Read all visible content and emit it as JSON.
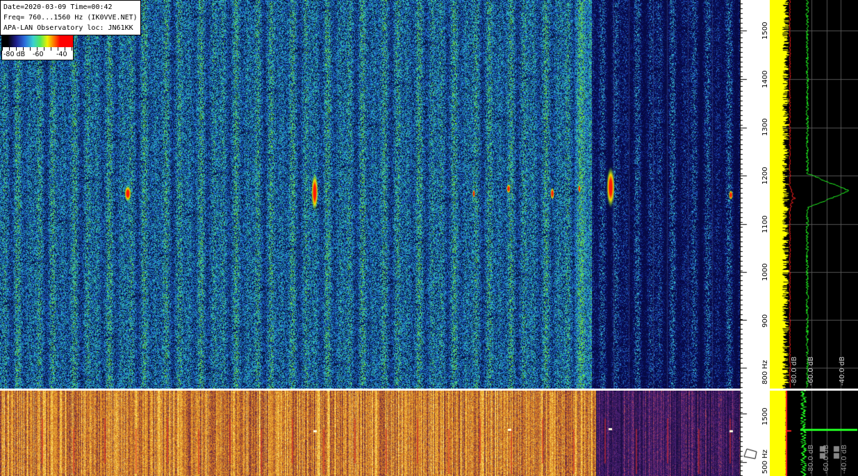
{
  "info": {
    "line1": "Date=2020-03-09 Time=00:42",
    "line2": "Freq= 760...1560 Hz (IK0VVE.NET)",
    "line3": "APA-LAN Observatory loc: JN61KK"
  },
  "colorbar": {
    "label_a": "-80 dB",
    "label_b": "-60",
    "label_c": "-40"
  },
  "freq_axis_top": {
    "ticks": [
      "1500",
      "1400",
      "1300",
      "1200",
      "1100",
      "1000",
      "900",
      "800 Hz"
    ]
  },
  "freq_axis_bottom": {
    "ticks": [
      "1500",
      "500 Hz"
    ]
  },
  "spectrum_top": {
    "labels": [
      "-80.0 dB",
      "-60.0 dB",
      "-40.0 dB"
    ]
  },
  "spectrum_bottom": {
    "labels": [
      "-80.0 dB",
      "-60.0 dB",
      "-40.0 dB"
    ]
  },
  "colors": {
    "background": "#000000",
    "trace_green": "#22ff22",
    "trace_red": "#ff2020",
    "fill_yellow": "#ffff00"
  }
}
